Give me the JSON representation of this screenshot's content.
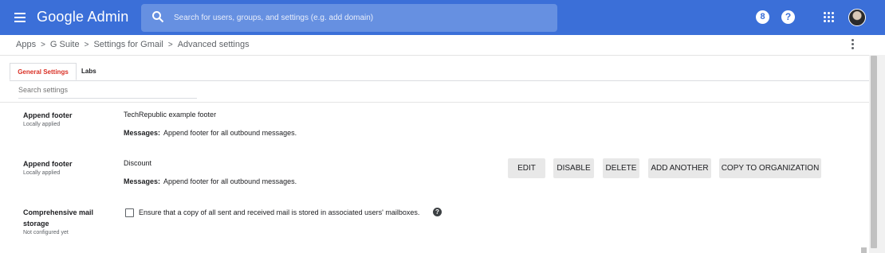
{
  "header": {
    "app_title": "Google Admin",
    "search_placeholder": "Search for users, groups, and settings (e.g. add domain)",
    "colors": {
      "bar": "#3b6fd8",
      "search": "#6690e1"
    },
    "icons": [
      "menu-icon",
      "search-icon",
      "support-icon",
      "help-icon",
      "apps-grid-icon",
      "avatar"
    ]
  },
  "breadcrumb": [
    "Apps",
    "G Suite",
    "Settings for Gmail",
    "Advanced settings"
  ],
  "tabs": [
    {
      "label": "General Settings",
      "active": true
    },
    {
      "label": "Labs",
      "active": false
    }
  ],
  "search_settings_placeholder": "Search settings",
  "settings": [
    {
      "title": "Append footer",
      "status": "Locally applied",
      "value": "TechRepublic example footer",
      "messages_label": "Messages:",
      "messages_text": "Append footer for all outbound messages."
    },
    {
      "title": "Append footer",
      "status": "Locally applied",
      "value": "Discount",
      "messages_label": "Messages:",
      "messages_text": "Append footer for all outbound messages.",
      "actions": [
        "EDIT",
        "DISABLE",
        "DELETE",
        "ADD ANOTHER",
        "COPY TO ORGANIZATION"
      ]
    },
    {
      "title_line1": "Comprehensive mail",
      "title_line2": "storage",
      "status": "Not configured yet",
      "checkbox_label": "Ensure that a copy of all sent and received mail is stored in associated users' mailboxes.",
      "checked": false
    }
  ]
}
